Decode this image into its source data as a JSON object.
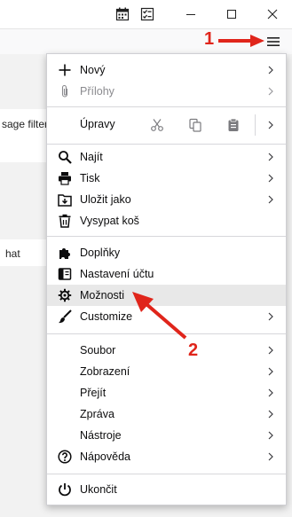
{
  "background": {
    "left_text_1": "sage filters",
    "left_text_2": "hat"
  },
  "menu": {
    "items": [
      {
        "label": "Nový",
        "icon": "plus-icon",
        "chevron": true,
        "dim": false
      },
      {
        "label": "Přílohy",
        "icon": "paperclip-icon",
        "chevron": true,
        "dim": true
      },
      {
        "label": "Úpravy"
      },
      {
        "label": "Najít",
        "icon": "search-icon",
        "chevron": true,
        "dim": false
      },
      {
        "label": "Tisk",
        "icon": "printer-icon",
        "chevron": true,
        "dim": false
      },
      {
        "label": "Uložit jako",
        "icon": "save-as-icon",
        "chevron": true,
        "dim": false
      },
      {
        "label": "Vysypat koš",
        "icon": "trash-icon",
        "chevron": false,
        "dim": false
      },
      {
        "label": "Doplňky",
        "icon": "puzzle-icon",
        "chevron": false,
        "dim": false
      },
      {
        "label": "Nastavení účtu",
        "icon": "account-settings-icon",
        "chevron": false,
        "dim": false
      },
      {
        "label": "Možnosti",
        "icon": "gear-icon",
        "chevron": false,
        "dim": false,
        "highlighted": true
      },
      {
        "label": "Customize",
        "icon": "brush-icon",
        "chevron": true,
        "dim": false
      },
      {
        "label": "Soubor",
        "chevron": true
      },
      {
        "label": "Zobrazení",
        "chevron": true
      },
      {
        "label": "Přejít",
        "chevron": true
      },
      {
        "label": "Zpráva",
        "chevron": true
      },
      {
        "label": "Nástroje",
        "chevron": true
      },
      {
        "label": "Nápověda",
        "icon": "help-icon",
        "chevron": true
      },
      {
        "label": "Ukončit",
        "icon": "power-icon",
        "chevron": false
      }
    ]
  },
  "annotations": {
    "num1": "1",
    "num2": "2",
    "color": "#e0251b"
  }
}
